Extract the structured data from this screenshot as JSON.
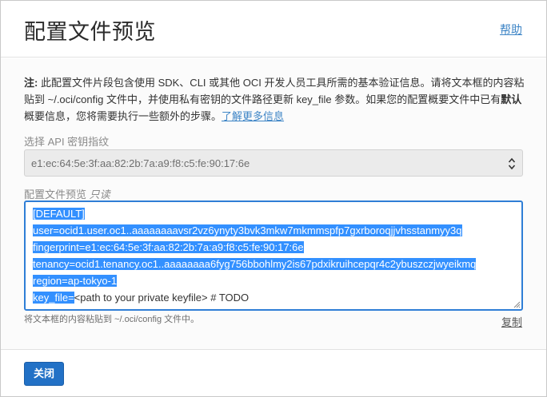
{
  "dialog": {
    "title": "配置文件预览",
    "help_label": "帮助"
  },
  "note": {
    "prefix": "注:",
    "text_1": "此配置文件片段包含使用 SDK、CLI 或其他 OCI 开发人员工具所需的基本验证信息。请将文本框的内容粘贴到 ~/.oci/config 文件中，并使用私有密钥的文件路径更新 key_file 参数。如果您的配置概要文件中已有",
    "bold_word": "默认",
    "text_2": "概要信息，您将需要执行一些额外的步骤。",
    "learn_more": "了解更多信息"
  },
  "key_field": {
    "label": "选择 API 密钥指纹",
    "value": "e1:ec:64:5e:3f:aa:82:2b:7a:a9:f8:c5:fe:90:17:6e"
  },
  "preview": {
    "label": "配置文件预览",
    "readonly": "只读",
    "lines": [
      "[DEFAULT]",
      "user=ocid1.user.oc1..aaaaaaaavsr2vz6ynyty3bvk3mkw7mkmmspfp7gxrboroqjjvhsstanmyy3q",
      "fingerprint=e1:ec:64:5e:3f:aa:82:2b:7a:a9:f8:c5:fe:90:17:6e",
      "tenancy=ocid1.tenancy.oc1..aaaaaaaa6fyg756bbohlmy2is67pdxikruihcepqr4c2ybuszczjwyeikmq",
      "region=ap-tokyo-1"
    ],
    "last_line_selected": "key_file=",
    "last_line_rest": "<path to your private keyfile> # TODO",
    "hint": "将文本框的内容粘贴到 ~/.oci/config 文件中。",
    "copy_label": "复制"
  },
  "footer": {
    "close_label": "关闭"
  },
  "colors": {
    "accent": "#2271c6",
    "selection": "#3390ff",
    "link": "#3e85c6"
  }
}
